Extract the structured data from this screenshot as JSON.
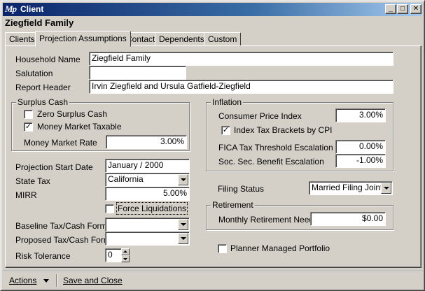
{
  "window": {
    "title": "Client",
    "app_icon": "Mp",
    "minimize_glyph": "_",
    "maximize_glyph": "□",
    "close_glyph": "✕"
  },
  "heading": "Ziegfield Family",
  "tabs": [
    {
      "label": "Clients",
      "active": false
    },
    {
      "label": "Projection Assumptions",
      "active": true
    },
    {
      "label": "Contact",
      "active": false
    },
    {
      "label": "Dependents",
      "active": false
    },
    {
      "label": "Custom",
      "active": false
    }
  ],
  "form": {
    "household_name_label": "Household Name",
    "household_name": "Ziegfield Family",
    "salutation_label": "Salutation",
    "salutation": "",
    "report_header_label": "Report Header",
    "report_header": "Irvin Ziegfield and Ursula Gatfield-Ziegfield",
    "surplus_cash": {
      "title": "Surplus Cash",
      "zero_surplus_label": "Zero Surplus Cash",
      "zero_surplus_checked": false,
      "mm_taxable_label": "Money Market Taxable",
      "mm_taxable_checked": true,
      "mm_rate_label": "Money Market Rate",
      "mm_rate": "3.00%"
    },
    "start_date_label": "Projection Start Date",
    "start_date": "January / 2000",
    "state_tax_label": "State Tax",
    "state_tax": "California",
    "mirr_label": "MIRR",
    "mirr": "5.00%",
    "force_liquidations_label": "Force Liquidations",
    "force_liquidations_checked": false,
    "baseline_form_label": "Baseline Tax/Cash Form",
    "baseline_form": "",
    "proposed_form_label": "Proposed Tax/Cash Form",
    "proposed_form": "",
    "risk_label": "Risk Tolerance",
    "risk": "0",
    "inflation": {
      "title": "Inflation",
      "cpi_label": "Consumer Price Index",
      "cpi": "3.00%",
      "index_brackets_label": "Index Tax Brackets by CPI",
      "index_brackets_checked": true,
      "fica_label": "FICA Tax Threshold Escalation",
      "fica": "0.00%",
      "ss_label": "Soc. Sec. Benefit Escalation",
      "ss": "-1.00%"
    },
    "filing_status_label": "Filing Status",
    "filing_status": "Married Filing Joint",
    "retirement": {
      "title": "Retirement",
      "needs_label": "Monthly Retirement Needs",
      "needs": "$0.00"
    },
    "planner_managed_label": "Planner Managed Portfolio",
    "planner_managed_checked": false
  },
  "statusbar": {
    "actions_label": "Actions",
    "save_close_label": "Save and Close"
  }
}
